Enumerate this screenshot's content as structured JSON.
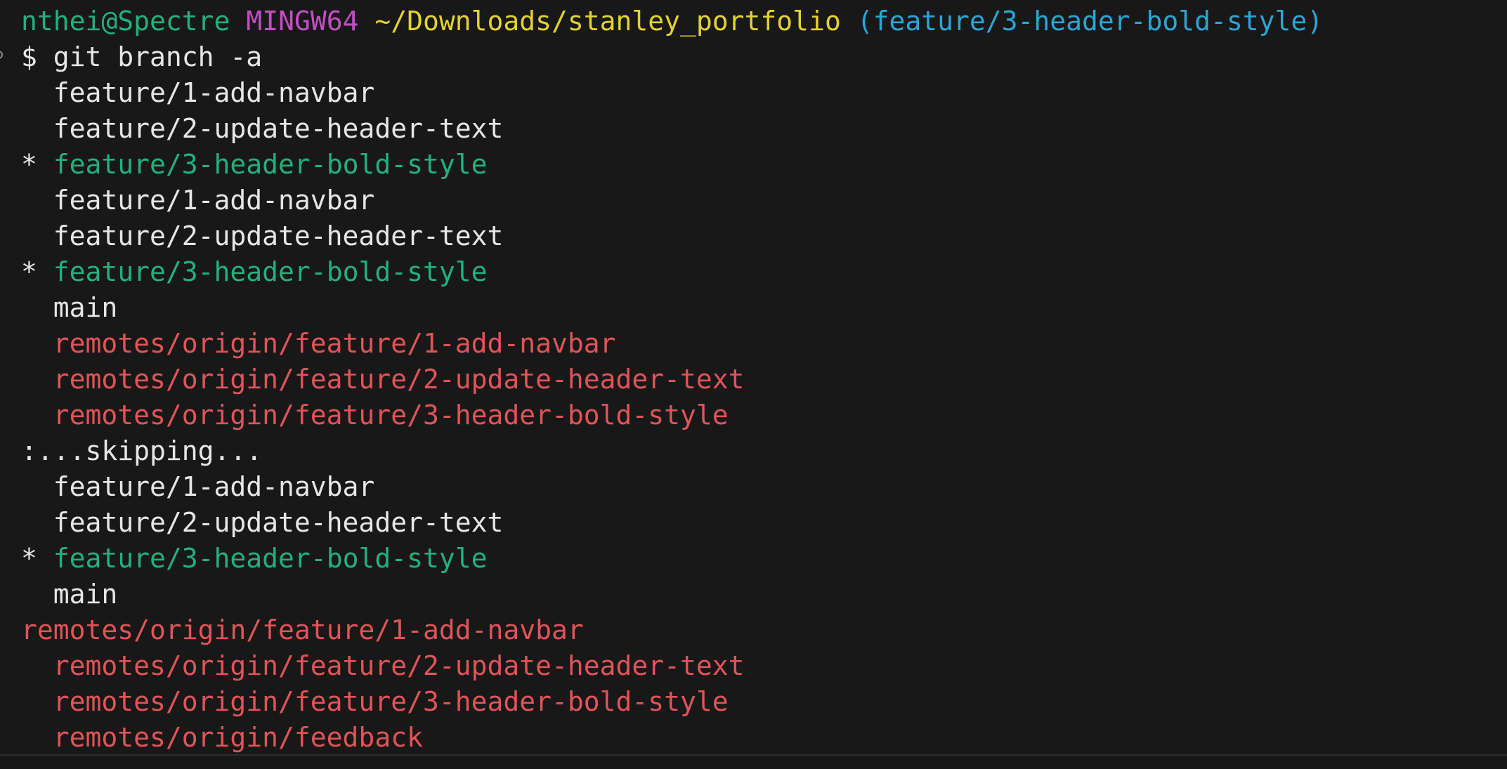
{
  "colors": {
    "background": "#181818",
    "user_host": "#23b07d",
    "shell_name": "#c24fc2",
    "path": "#e4d22e",
    "git_branch": "#2aa6d6",
    "text": "#e6e6e6",
    "current_branch": "#23b07d",
    "remote_branch": "#e05458"
  },
  "prompt": {
    "user_host": "nthei@Spectre",
    "shell": "MINGW64",
    "path": "~/Downloads/stanley_portfolio",
    "branch": "(feature/3-header-bold-style)"
  },
  "command": "$ git branch -a",
  "lines": [
    "  feature/1-add-navbar",
    "  feature/2-update-header-text",
    "* feature/3-header-bold-style",
    "  feature/1-add-navbar",
    "  feature/2-update-header-text",
    "* feature/3-header-bold-style",
    "  main",
    "  remotes/origin/feature/1-add-navbar",
    "  remotes/origin/feature/2-update-header-text",
    "  remotes/origin/feature/3-header-bold-style",
    ":...skipping...",
    "  feature/1-add-navbar",
    "  feature/2-update-header-text",
    "* feature/3-header-bold-style",
    "  main",
    "remotes/origin/feature/1-add-navbar",
    "  remotes/origin/feature/2-update-header-text",
    "  remotes/origin/feature/3-header-bold-style",
    "  remotes/origin/feedback"
  ],
  "line_styles": [
    "local",
    "local",
    "current",
    "local",
    "local",
    "current",
    "local",
    "remote",
    "remote",
    "remote",
    "info",
    "local",
    "local",
    "current",
    "local",
    "remote",
    "remote",
    "remote",
    "remote"
  ]
}
